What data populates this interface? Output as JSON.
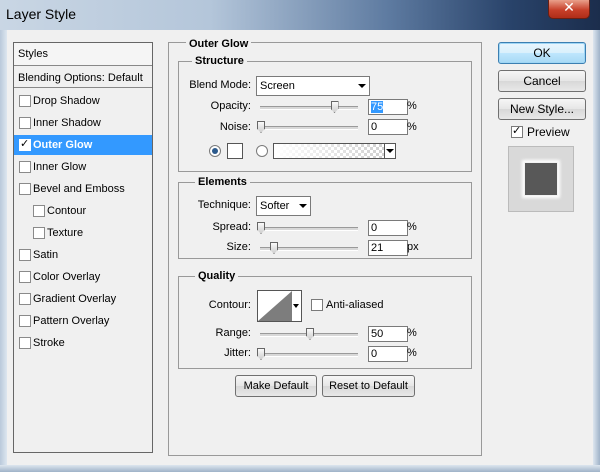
{
  "window": {
    "title": "Layer Style",
    "close_glyph": "✕"
  },
  "sidebar": {
    "header": "Styles",
    "blending_options": "Blending Options: Default",
    "items": [
      {
        "label": "Drop Shadow",
        "checked": false,
        "indent": false,
        "selected": false
      },
      {
        "label": "Inner Shadow",
        "checked": false,
        "indent": false,
        "selected": false
      },
      {
        "label": "Outer Glow",
        "checked": true,
        "indent": false,
        "selected": true
      },
      {
        "label": "Inner Glow",
        "checked": false,
        "indent": false,
        "selected": false
      },
      {
        "label": "Bevel and Emboss",
        "checked": false,
        "indent": false,
        "selected": false
      },
      {
        "label": "Contour",
        "checked": false,
        "indent": true,
        "selected": false
      },
      {
        "label": "Texture",
        "checked": false,
        "indent": true,
        "selected": false
      },
      {
        "label": "Satin",
        "checked": false,
        "indent": false,
        "selected": false
      },
      {
        "label": "Color Overlay",
        "checked": false,
        "indent": false,
        "selected": false
      },
      {
        "label": "Gradient Overlay",
        "checked": false,
        "indent": false,
        "selected": false
      },
      {
        "label": "Pattern Overlay",
        "checked": false,
        "indent": false,
        "selected": false
      },
      {
        "label": "Stroke",
        "checked": false,
        "indent": false,
        "selected": false
      }
    ]
  },
  "panel": {
    "title": "Outer Glow",
    "structure": {
      "title": "Structure",
      "blend_mode_label": "Blend Mode:",
      "blend_mode_value": "Screen",
      "opacity_label": "Opacity:",
      "opacity_value": "75",
      "noise_label": "Noise:",
      "noise_value": "0",
      "percent": "%",
      "glow_source": "color",
      "glow_color": "#ffffff"
    },
    "elements": {
      "title": "Elements",
      "technique_label": "Technique:",
      "technique_value": "Softer",
      "spread_label": "Spread:",
      "spread_value": "0",
      "size_label": "Size:",
      "size_value": "21",
      "percent": "%",
      "px": "px"
    },
    "quality": {
      "title": "Quality",
      "contour_label": "Contour:",
      "anti_aliased_label": "Anti-aliased",
      "anti_aliased": false,
      "range_label": "Range:",
      "range_value": "50",
      "jitter_label": "Jitter:",
      "jitter_value": "0",
      "percent": "%"
    },
    "make_default": "Make Default",
    "reset_to_default": "Reset to Default"
  },
  "buttons": {
    "ok": "OK",
    "cancel": "Cancel",
    "new_style": "New Style..."
  },
  "preview": {
    "label": "Preview",
    "checked": true
  }
}
